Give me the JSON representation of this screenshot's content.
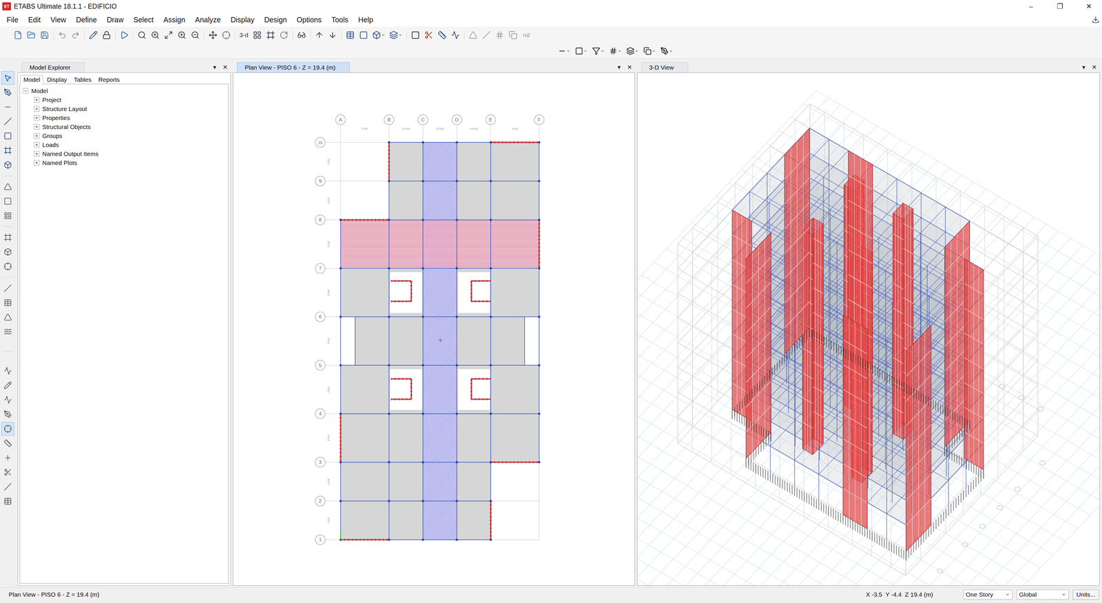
{
  "window": {
    "title": "ETABS Ultimate 18.1.1 - EDIFICIO",
    "app_icon": "ET",
    "controls": [
      "–",
      "❐",
      "✕"
    ]
  },
  "menu": [
    "File",
    "Edit",
    "View",
    "Define",
    "Draw",
    "Select",
    "Assign",
    "Analyze",
    "Display",
    "Design",
    "Options",
    "Tools",
    "Help"
  ],
  "toolbar": {
    "view_3d": {
      "label": "3-d",
      "disabled": false
    },
    "last": {
      "label": "nd",
      "disabled": true
    }
  },
  "left_toolbar": [
    {
      "selected": true
    },
    {
      "selected": false
    },
    {
      "selected": false
    },
    {
      "selected": false
    },
    {
      "selected": false
    },
    {
      "selected": false
    },
    {
      "selected": false
    },
    {
      "selected": false
    },
    {
      "selected": false
    },
    {
      "selected": false
    },
    {
      "selected": false
    },
    {
      "selected": false
    },
    {
      "selected": false
    },
    {
      "selected": false
    },
    {
      "selected": false
    },
    {
      "selected": false
    },
    {
      "selected": false
    },
    {
      "selected": false
    },
    {
      "selected": false
    },
    {
      "selected": false
    },
    {
      "selected": false
    },
    {
      "selected": true
    },
    {
      "selected": false
    },
    {
      "selected": false
    },
    {
      "selected": false
    },
    {
      "selected": false
    },
    {
      "selected": false
    }
  ],
  "model_explorer": {
    "title": "Model Explorer",
    "controls": [
      "▾",
      "✕"
    ],
    "tabs": [
      {
        "label": "Model",
        "selected": true
      },
      {
        "label": "Display",
        "selected": false
      },
      {
        "label": "Tables",
        "selected": false
      },
      {
        "label": "Reports",
        "selected": false
      }
    ],
    "tree": [
      {
        "label": "Model",
        "expanded": true,
        "depth": 0
      },
      {
        "label": "Project",
        "expanded": false,
        "depth": 1
      },
      {
        "label": "Structure Layout",
        "expanded": false,
        "depth": 1
      },
      {
        "label": "Properties",
        "expanded": false,
        "depth": 1
      },
      {
        "label": "Structural Objects",
        "expanded": false,
        "depth": 1
      },
      {
        "label": "Groups",
        "expanded": false,
        "depth": 1
      },
      {
        "label": "Loads",
        "expanded": false,
        "depth": 1
      },
      {
        "label": "Named Output Items",
        "expanded": false,
        "depth": 1
      },
      {
        "label": "Named Plots",
        "expanded": false,
        "depth": 1
      }
    ]
  },
  "plan_view": {
    "title": "Plan View - PISO 6 - Z = 19.4 (m)",
    "selected": true,
    "controls": [
      "▾",
      "✕"
    ],
    "grid_columns": [
      "A",
      "B",
      "C",
      "D",
      "E",
      "F"
    ],
    "grid_rows": [
      "10",
      "9",
      "8",
      "7",
      "6",
      "5",
      "4",
      "3",
      "2",
      "1"
    ],
    "column_dims": [
      "5 (m)",
      "3.5 (m)",
      "3.5 (m)",
      "3.5 (m)",
      "5 (m)"
    ],
    "row_dims": [
      "4 (m)",
      "4 (m)",
      "5 (m)",
      "5 (m)",
      "5 (m)",
      "5 (m)",
      "5 (m)",
      "4 (m)",
      "4 (m)"
    ]
  },
  "view_3d": {
    "title": "3-D View",
    "selected": false,
    "controls": [
      "▾",
      "✕"
    ]
  },
  "status_bar": {
    "text": "Plan View - PISO 6 - Z = 19.4 (m)",
    "coordinates": "X -3.5  Y -4.4  Z 19.4 (m)",
    "story_mode": "One Story",
    "coord_system": "Global",
    "units": "Units..."
  }
}
